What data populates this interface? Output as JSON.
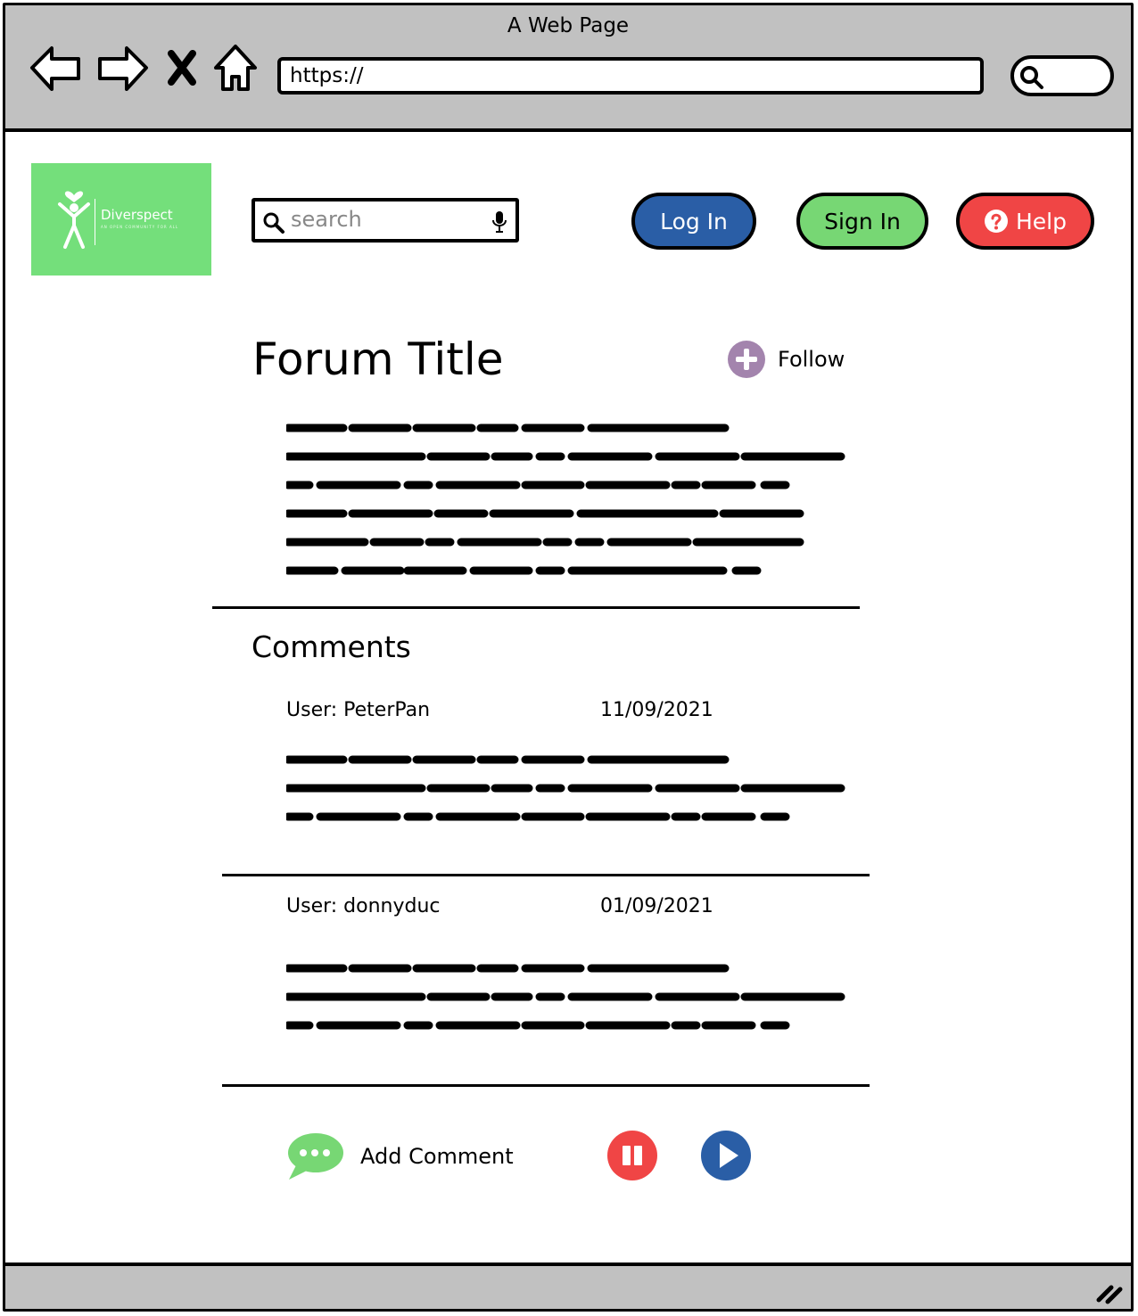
{
  "window": {
    "title": "A Web Page"
  },
  "browser": {
    "url": "https://",
    "nav_icons": [
      "back-arrow-icon",
      "forward-arrow-icon",
      "close-x-icon",
      "home-icon"
    ],
    "search_icon": "magnifier-icon"
  },
  "site": {
    "logo_name": "Diverspect",
    "logo_tagline": "AN OPEN COMMUNITY FOR ALL",
    "brand_color": "#74df7b"
  },
  "header": {
    "search_placeholder": "search",
    "login_label": "Log In",
    "signin_label": "Sign In",
    "help_label": "Help",
    "login_color": "#2a5ea6",
    "signin_color": "#77d774",
    "help_color": "#f04545"
  },
  "forum": {
    "title": "Forum Title",
    "follow_label": "Follow",
    "follow_icon_color": "#a384ad"
  },
  "comments": {
    "heading": "Comments",
    "items": [
      {
        "user": "User: PeterPan",
        "date": "11/09/2021"
      },
      {
        "user": "User: donnyduc",
        "date": "01/09/2021"
      }
    ]
  },
  "actions": {
    "add_comment_label": "Add Comment",
    "add_comment_icon": "chat-bubble-icon",
    "pause_icon": "pause-icon",
    "play_icon": "play-icon"
  }
}
